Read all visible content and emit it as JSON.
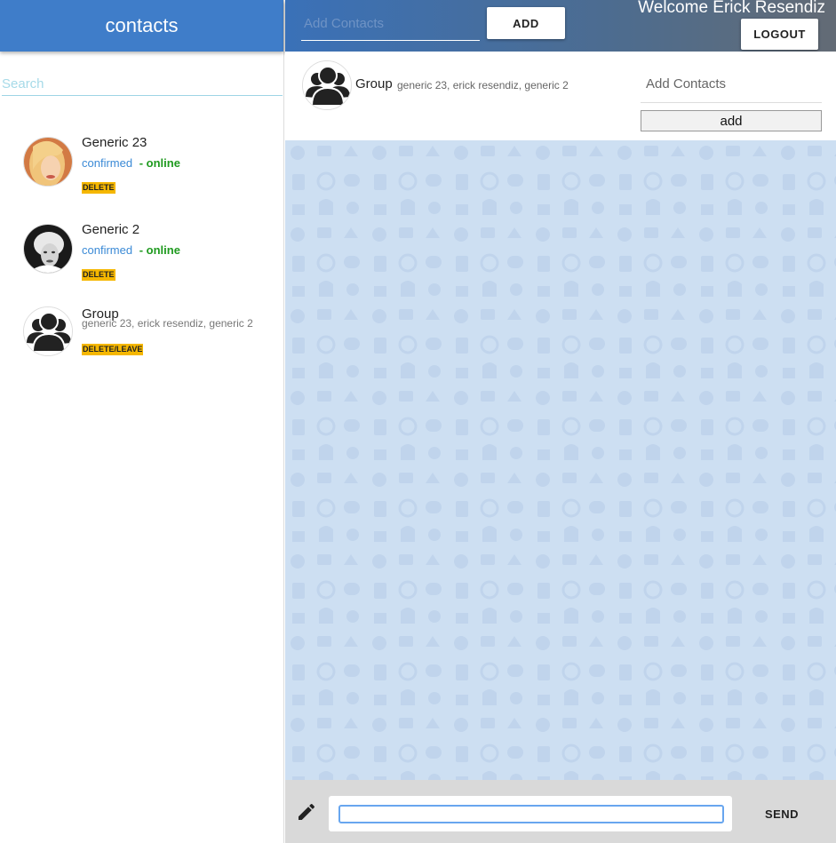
{
  "sidebar": {
    "title": "contacts",
    "search_placeholder": "Search",
    "contacts": [
      {
        "name": "Generic 23",
        "status": "confirmed",
        "presence": "- online",
        "action": "DELETE",
        "avatar": "blonde-woman-photo"
      },
      {
        "name": "Generic 2",
        "status": "confirmed",
        "presence": "- online",
        "action": "DELETE",
        "avatar": "marilyn-bw-photo"
      }
    ],
    "group": {
      "name": "Group",
      "members": "generic 23, erick resendiz, generic 2",
      "action": "DELETE/LEAVE",
      "avatar": "group-icon"
    }
  },
  "topbar": {
    "add_placeholder": "Add Contacts",
    "add_button": "ADD",
    "welcome": "Welcome Erick Resendiz",
    "logout_button": "LOGOUT"
  },
  "chat_header": {
    "name": "Group",
    "members": "generic 23, erick resendiz, generic 2",
    "add_contacts_placeholder": "Add Contacts",
    "add_button": "add"
  },
  "footer": {
    "edit_icon": "pencil-icon",
    "message_value": "",
    "send_button": "SEND"
  },
  "colors": {
    "header_blue": "#3f7dc9",
    "chat_background": "#cddff2",
    "badge_yellow": "#f5b700",
    "online_green": "#1f9a1f",
    "confirmed_blue": "#3b8ad6"
  }
}
